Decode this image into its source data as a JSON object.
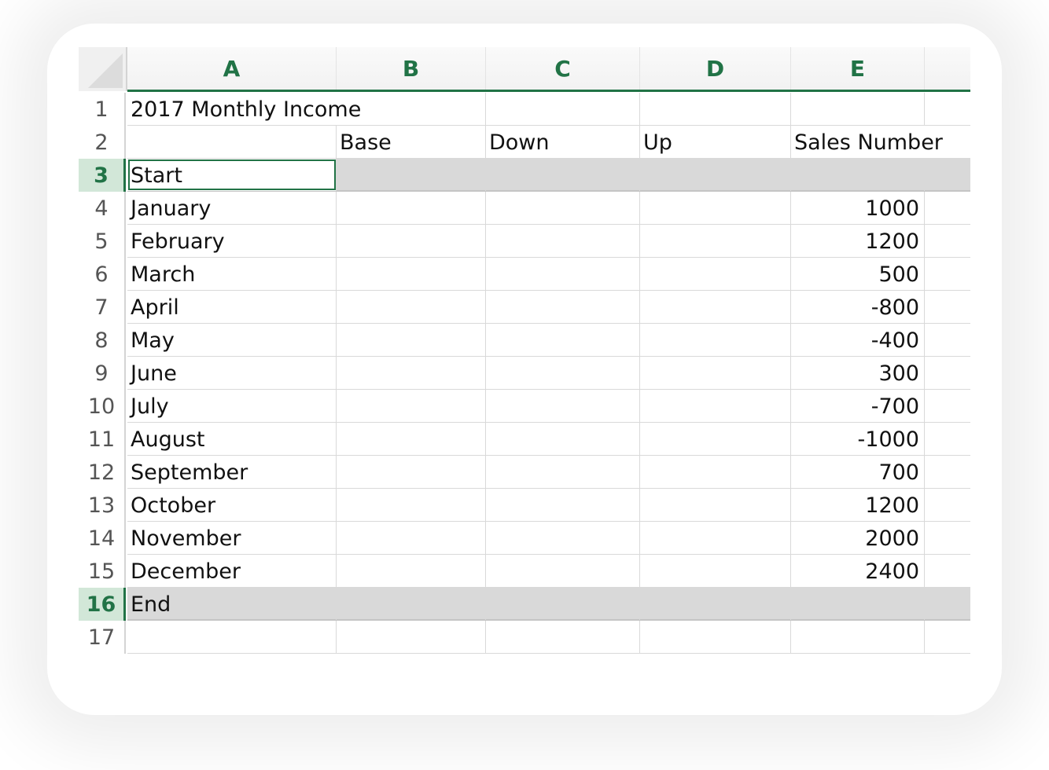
{
  "columns": [
    "A",
    "B",
    "C",
    "D",
    "E"
  ],
  "row_numbers": [
    "1",
    "2",
    "3",
    "4",
    "5",
    "6",
    "7",
    "8",
    "9",
    "10",
    "11",
    "12",
    "13",
    "14",
    "15",
    "16",
    "17"
  ],
  "selection": {
    "accent": "#217346",
    "selected_rows": [
      "3",
      "16"
    ],
    "active_cell": "A3"
  },
  "cells": {
    "title": "2017 Monthly Income",
    "headers": {
      "b": "Base",
      "c": "Down",
      "d": "Up",
      "e": "Sales Number"
    },
    "rows": [
      {
        "label": "Start",
        "sales": ""
      },
      {
        "label": "January",
        "sales": "1000"
      },
      {
        "label": "February",
        "sales": "1200"
      },
      {
        "label": "March",
        "sales": "500"
      },
      {
        "label": "April",
        "sales": "-800"
      },
      {
        "label": "May",
        "sales": "-400"
      },
      {
        "label": "June",
        "sales": "300"
      },
      {
        "label": "July",
        "sales": "-700"
      },
      {
        "label": "August",
        "sales": "-1000"
      },
      {
        "label": "September",
        "sales": "700"
      },
      {
        "label": "October",
        "sales": "1200"
      },
      {
        "label": "November",
        "sales": "2000"
      },
      {
        "label": "December",
        "sales": "2400"
      },
      {
        "label": "End",
        "sales": ""
      }
    ]
  }
}
